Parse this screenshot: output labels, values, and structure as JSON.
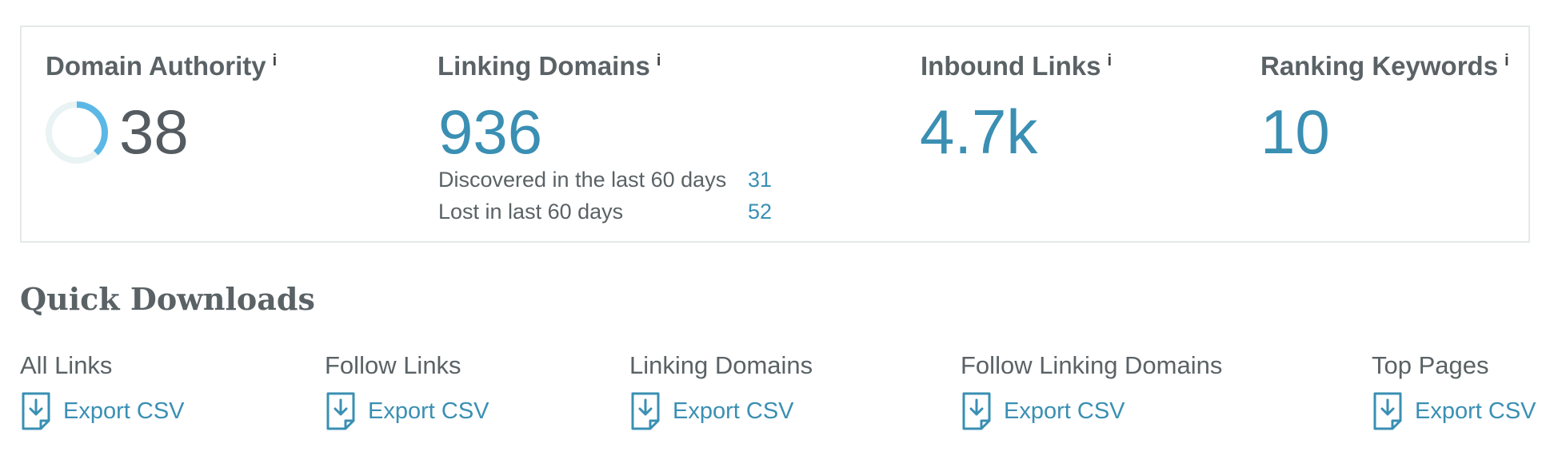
{
  "metrics": {
    "domain_authority": {
      "label": "Domain Authority",
      "info": "i",
      "value": "38",
      "score": 38,
      "ring_color": "#5bb8e6",
      "track_color": "#eaf3f3"
    },
    "linking_domains": {
      "label": "Linking Domains",
      "info": "i",
      "value": "936",
      "discovered_label": "Discovered in the last 60 days",
      "discovered_value": "31",
      "lost_label": "Lost in last 60 days",
      "lost_value": "52"
    },
    "inbound_links": {
      "label": "Inbound Links",
      "info": "i",
      "value": "4.7k"
    },
    "ranking_keywords": {
      "label": "Ranking Keywords",
      "info": "i",
      "value": "10"
    }
  },
  "quick_downloads": {
    "title": "Quick Downloads",
    "items": [
      {
        "label": "All Links",
        "action": "Export CSV",
        "icon": "download-file-icon"
      },
      {
        "label": "Follow Links",
        "action": "Export CSV",
        "icon": "download-file-icon"
      },
      {
        "label": "Linking Domains",
        "action": "Export CSV",
        "icon": "download-file-icon"
      },
      {
        "label": "Follow Linking Domains",
        "action": "Export CSV",
        "icon": "download-file-icon"
      },
      {
        "label": "Top Pages",
        "action": "Export CSV",
        "icon": "download-file-icon"
      }
    ]
  },
  "colors": {
    "accent": "#3a8fb3",
    "text": "#5a6266",
    "border": "#e4e8e9"
  }
}
